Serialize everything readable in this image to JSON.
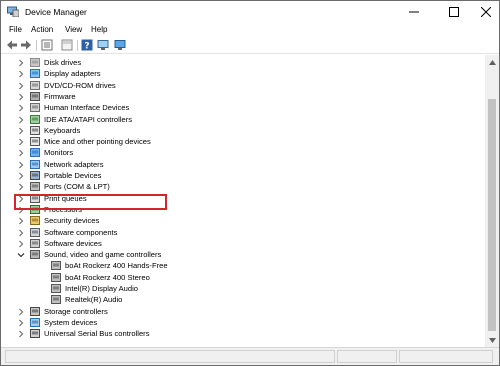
{
  "window": {
    "title": "Device Manager",
    "app_icon": "device-manager-icon"
  },
  "controls": {
    "minimize": "minimize-icon",
    "maximize": "maximize-icon",
    "close": "close-icon"
  },
  "menu": [
    "File",
    "Action",
    "View",
    "Help"
  ],
  "toolbar": [
    "back-icon",
    "forward-icon",
    "properties-icon",
    "show-hidden-icon",
    "help-icon",
    "monitor-icon"
  ],
  "tree": {
    "items": [
      {
        "label": "Disk drives",
        "icon": "disk-drive-icon",
        "expander": "collapsed"
      },
      {
        "label": "Display adapters",
        "icon": "display-adapter-icon",
        "expander": "collapsed"
      },
      {
        "label": "DVD/CD-ROM drives",
        "icon": "dvd-drive-icon",
        "expander": "collapsed"
      },
      {
        "label": "Firmware",
        "icon": "firmware-icon",
        "expander": "collapsed"
      },
      {
        "label": "Human Interface Devices",
        "icon": "hid-icon",
        "expander": "collapsed"
      },
      {
        "label": "IDE ATA/ATAPI controllers",
        "icon": "ide-controller-icon",
        "expander": "collapsed"
      },
      {
        "label": "Keyboards",
        "icon": "keyboard-icon",
        "expander": "collapsed"
      },
      {
        "label": "Mice and other pointing devices",
        "icon": "mouse-icon",
        "expander": "collapsed"
      },
      {
        "label": "Monitors",
        "icon": "monitor-icon",
        "expander": "collapsed"
      },
      {
        "label": "Network adapters",
        "icon": "network-adapter-icon",
        "expander": "collapsed"
      },
      {
        "label": "Portable Devices",
        "icon": "portable-device-icon",
        "expander": "collapsed"
      },
      {
        "label": "Ports (COM & LPT)",
        "icon": "ports-icon",
        "expander": "collapsed"
      },
      {
        "label": "Print queues",
        "icon": "printer-icon",
        "expander": "collapsed"
      },
      {
        "label": "Processors",
        "icon": "processor-icon",
        "expander": "collapsed"
      },
      {
        "label": "Security devices",
        "icon": "security-device-icon",
        "expander": "collapsed"
      },
      {
        "label": "Software components",
        "icon": "software-component-icon",
        "expander": "collapsed"
      },
      {
        "label": "Software devices",
        "icon": "software-device-icon",
        "expander": "collapsed"
      },
      {
        "label": "Sound, video and game controllers",
        "icon": "sound-controller-icon",
        "expander": "expanded"
      },
      {
        "label": "boAt Rockerz 400 Hands-Free",
        "icon": "audio-device-icon",
        "expander": "none",
        "child": true
      },
      {
        "label": "boAt Rockerz 400 Stereo",
        "icon": "audio-device-icon",
        "expander": "none",
        "child": true
      },
      {
        "label": "Intel(R) Display Audio",
        "icon": "audio-device-icon",
        "expander": "none",
        "child": true
      },
      {
        "label": "Realtek(R) Audio",
        "icon": "audio-device-icon",
        "expander": "none",
        "child": true
      },
      {
        "label": "Storage controllers",
        "icon": "storage-controller-icon",
        "expander": "collapsed"
      },
      {
        "label": "System devices",
        "icon": "system-device-icon",
        "expander": "collapsed"
      },
      {
        "label": "Universal Serial Bus controllers",
        "icon": "usb-controller-icon",
        "expander": "collapsed"
      }
    ]
  },
  "scrollbar": {
    "up": "scroll-up-arrow-icon",
    "down": "scroll-down-arrow-icon"
  }
}
